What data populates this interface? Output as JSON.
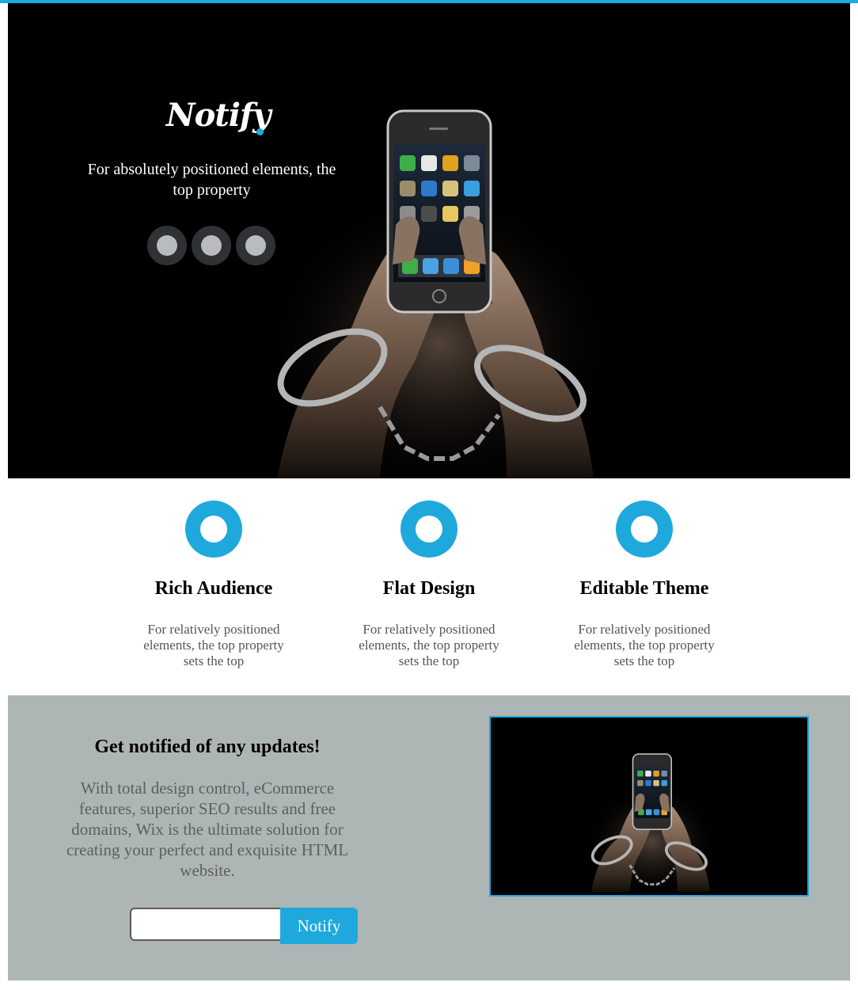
{
  "brand": {
    "logo_text": "Notify",
    "accent_color": "#1fa8dc"
  },
  "hero": {
    "tagline": "For absolutely positioned elements, the top property",
    "slider_dots": [
      {
        "label": "slide-1"
      },
      {
        "label": "slide-2"
      },
      {
        "label": "slide-3"
      }
    ],
    "image_subject": "handcuffed hands holding a smartphone"
  },
  "features": [
    {
      "icon": "ring-icon",
      "title": "Rich Audience",
      "text": "For relatively positioned elements, the top property sets the top"
    },
    {
      "icon": "ring-icon",
      "title": "Flat Design",
      "text": "For relatively positioned elements, the top property sets the top"
    },
    {
      "icon": "ring-icon",
      "title": "Editable Theme",
      "text": "For relatively positioned elements, the top property sets the top"
    }
  ],
  "signup": {
    "title": "Get notified of any updates!",
    "text": "With total design control, eCommerce features, superior SEO results and free domains, Wix is the ultimate solution for creating your perfect and exquisite HTML website.",
    "email_value": "",
    "button_label": "Notify",
    "background_color": "#aeb5b5"
  }
}
